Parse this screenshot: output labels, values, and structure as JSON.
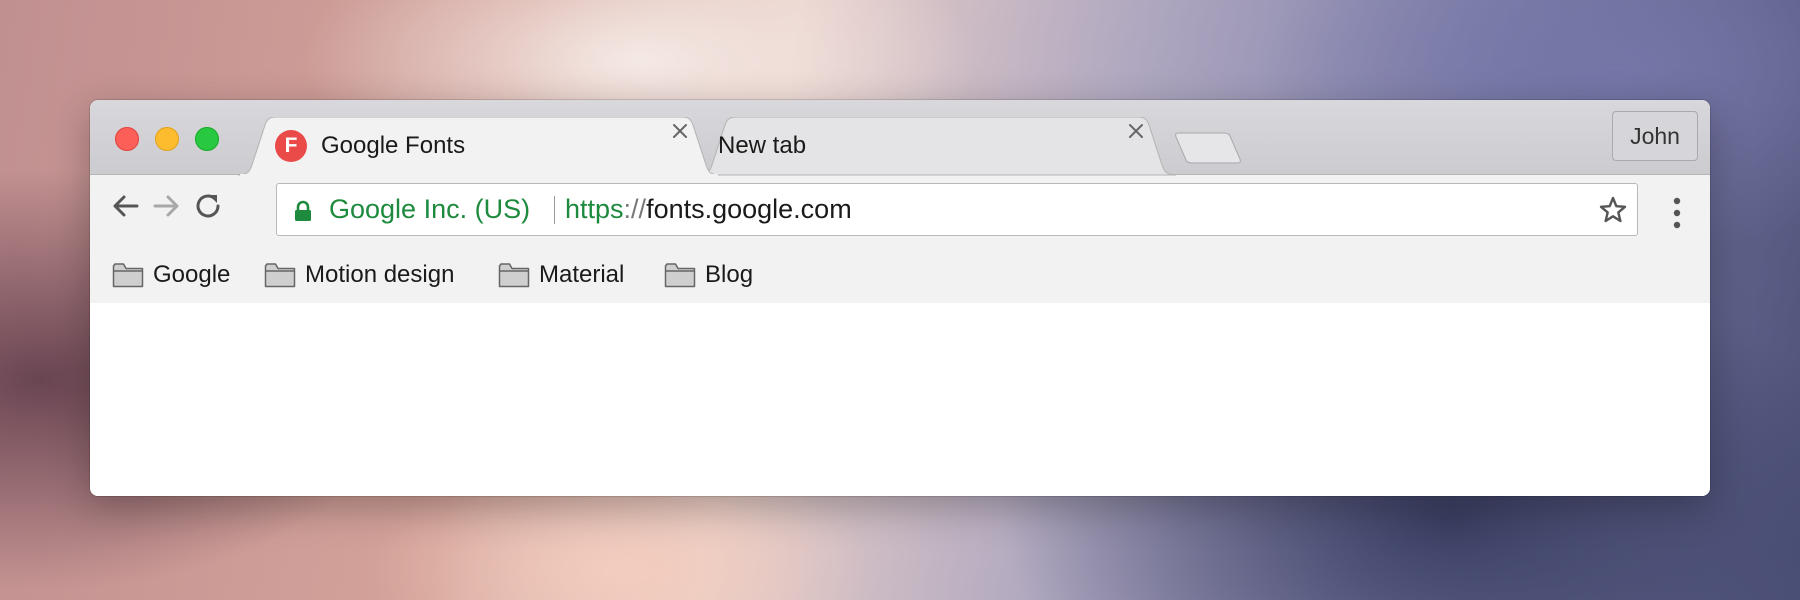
{
  "tabs": [
    {
      "title": "Google Fonts",
      "favicon_letter": "F",
      "favicon_color": "#ea4b48",
      "active": true
    },
    {
      "title": "New tab",
      "active": false
    }
  ],
  "profile": {
    "name": "John"
  },
  "omnibox": {
    "security_org": "Google Inc. (US)",
    "url_scheme": "https",
    "url_separator": "://",
    "url_host": "fonts.google.com",
    "secure_color": "#1e8a3e"
  },
  "bookmarks": [
    {
      "label": "Google",
      "icon": "folder-icon"
    },
    {
      "label": "Motion design",
      "icon": "folder-icon"
    },
    {
      "label": "Material",
      "icon": "folder-icon"
    },
    {
      "label": "Blog",
      "icon": "folder-icon"
    }
  ],
  "icons": {
    "back": "arrow-back-icon",
    "forward": "arrow-forward-icon",
    "reload": "reload-icon",
    "lock": "lock-icon",
    "star": "star-icon",
    "menu": "more-vert-icon",
    "close": "close-icon"
  }
}
